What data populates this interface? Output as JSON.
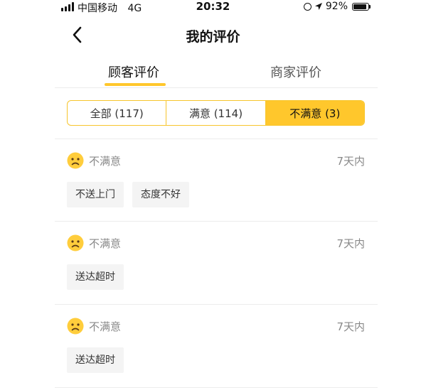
{
  "status_bar": {
    "carrier": "中国移动",
    "network": "4G",
    "time": "20:32",
    "battery": "92%",
    "battery_level": 0.92
  },
  "header": {
    "title": "我的评价"
  },
  "tabs": [
    {
      "label": "顾客评价",
      "active": true
    },
    {
      "label": "商家评价",
      "active": false
    }
  ],
  "filters": [
    {
      "label": "全部 (117)",
      "active": false
    },
    {
      "label": "满意 (114)",
      "active": false
    },
    {
      "label": "不满意 (3)",
      "active": true
    }
  ],
  "reviews": [
    {
      "rating": "不满意",
      "time": "7天内",
      "tags": [
        "不送上门",
        "态度不好"
      ]
    },
    {
      "rating": "不满意",
      "time": "7天内",
      "tags": [
        "送达超时"
      ]
    },
    {
      "rating": "不满意",
      "time": "7天内",
      "tags": [
        "送达超时"
      ]
    }
  ],
  "colors": {
    "accent": "#ffc72c",
    "accent_border": "#f7c52d",
    "emoji": "#ffcd3c",
    "muted_text": "#888888",
    "tag_bg": "#f4f4f4"
  },
  "icons": {
    "back": "chevron-left-icon",
    "rating": "sad-face-icon",
    "location": "location-arrow-icon",
    "lock": "orientation-lock-icon"
  }
}
